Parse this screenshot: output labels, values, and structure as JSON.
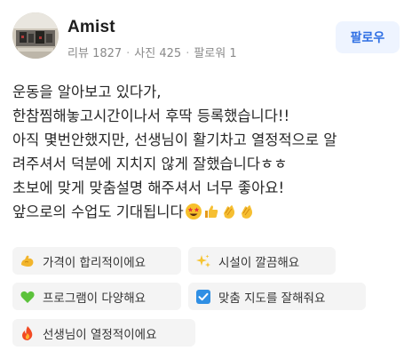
{
  "reviewer": {
    "name": "Amist",
    "stats": [
      {
        "label": "리뷰",
        "value": "1827"
      },
      {
        "label": "사진",
        "value": "425"
      },
      {
        "label": "팔로워",
        "value": "1"
      }
    ],
    "follow_label": "팔로우"
  },
  "review": {
    "lines": [
      "운동을 알아보고 있다가,",
      "한참찜해놓고시간이나서 후딱 등록했습니다!!",
      "아직 몇번안했지만, 선생님이 활기차고 열정적으로 알",
      "려주셔서 덕분에 지치지 않게 잘했습니다ㅎㅎ",
      "초보에 맞게 맞춤설명 해주셔서 너무 좋아요!",
      "앞으로의 수업도 기대됩니다"
    ],
    "trailing_emojis": [
      "star-struck-icon",
      "thumbs-up-icon",
      "clapping-hands-icon",
      "clapping-hands-icon"
    ]
  },
  "tags": [
    {
      "icon": "muscle-icon",
      "label": "가격이 합리적이에요"
    },
    {
      "icon": "sparkles-icon",
      "label": "시설이 깔끔해요"
    },
    {
      "icon": "green-heart-icon",
      "label": "프로그램이 다양해요"
    },
    {
      "icon": "check-box-icon",
      "label": "맞춤 지도를 잘해줘요"
    },
    {
      "icon": "fire-icon",
      "label": "선생님이 열정적이에요"
    }
  ],
  "colors": {
    "follow_bg": "#eef4ff",
    "follow_text": "#2f6fe4",
    "tag_bg": "#f4f4f4",
    "meta_text": "#8a8a8a"
  }
}
